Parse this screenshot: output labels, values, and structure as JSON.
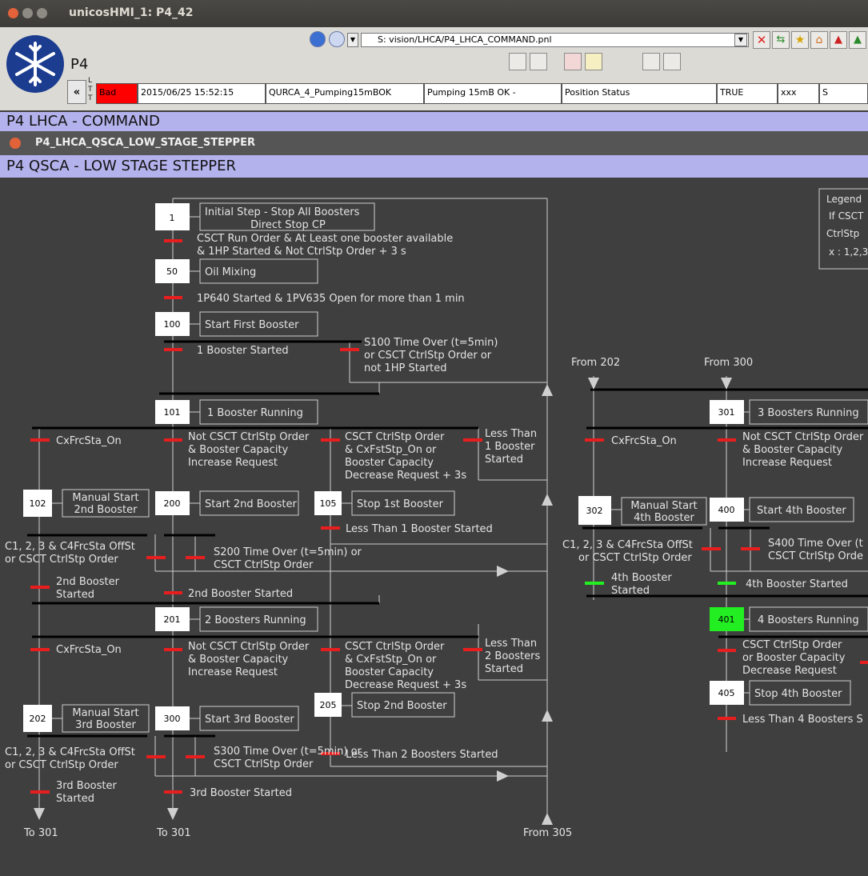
{
  "window": {
    "title": "unicosHMI_1: P4_42"
  },
  "toolbar": {
    "panel_name": "P4",
    "url": "S: vision/LHCA/P4_LHCA_COMMAND.pnl",
    "collapse_label": "«",
    "ltt_label": "L T T"
  },
  "alarm": {
    "status": "Bad",
    "timestamp": "2015/06/25 15:52:15",
    "object": "QURCA_4_Pumping15mBOK",
    "description": "Pumping 15mB OK -",
    "domain": "Position Status",
    "value": "TRUE",
    "extra1": "xxx",
    "extra2": "S"
  },
  "panel": {
    "header": "P4 LHCA - COMMAND",
    "subpanel_title": "P4_LHCA_QSCA_LOW_STAGE_STEPPER",
    "title": "P4 QSCA - LOW STAGE STEPPER"
  },
  "colors": {
    "active_step": "#22ee22",
    "transition_false": "#e81e1e",
    "transition_true": "#22ee22",
    "header_bg": "#b4b2ec",
    "alarm_red": "#ff0000"
  },
  "legend": {
    "title": "Legend",
    "line1": "If CSCT",
    "line2": "CtrlStp",
    "line3": "x : 1,2,3"
  },
  "steps": {
    "s1": {
      "num": "1",
      "line1": "Initial Step - Stop All Boosters",
      "line2": "Direct Stop CP"
    },
    "s50": {
      "num": "50",
      "label": "Oil Mixing"
    },
    "s100": {
      "num": "100",
      "label": "Start First Booster"
    },
    "s101": {
      "num": "101",
      "label": "1 Booster Running"
    },
    "s102": {
      "num": "102",
      "line1": "Manual Start",
      "line2": "2nd Booster"
    },
    "s200": {
      "num": "200",
      "label": "Start 2nd Booster"
    },
    "s105": {
      "num": "105",
      "label": "Stop 1st Booster"
    },
    "s201": {
      "num": "201",
      "label": "2 Boosters Running"
    },
    "s202": {
      "num": "202",
      "line1": "Manual Start",
      "line2": "3rd Booster"
    },
    "s300": {
      "num": "300",
      "label": "Start 3rd Booster"
    },
    "s205": {
      "num": "205",
      "label": "Stop 2nd Booster"
    },
    "s301": {
      "num": "301",
      "label": "3 Boosters Running"
    },
    "s302": {
      "num": "302",
      "line1": "Manual Start",
      "line2": "4th Booster"
    },
    "s400": {
      "num": "400",
      "label": "Start 4th Booster"
    },
    "s401": {
      "num": "401",
      "label": "4 Boosters Running"
    },
    "s405": {
      "num": "405",
      "label": "Stop 4th Booster"
    }
  },
  "transitions": {
    "t1_l1": "CSCT Run Order &  At Least one booster available",
    "t1_l2": "& 1HP Started &  Not CtrlStp Order + 3 s",
    "t50": "1P640 Started & 1PV635 Open for more than 1 min",
    "t100a": "1 Booster Started",
    "t100b_l1": "S100 Time Over (t=5min)",
    "t100b_l2": "or CSCT CtrlStp Order or",
    "t100b_l3": "not 1HP Started",
    "t101a": "CxFrcSta_On",
    "t101b_l1": "Not CSCT CtrlStp Order",
    "t101b_l2": "& Booster Capacity",
    "t101b_l3": "Increase Request",
    "t101c_l1": "CSCT CtrlStp Order",
    "t101c_l2": "& CxFstStp_On or",
    "t101c_l3": "Booster Capacity",
    "t101c_l4": "Decrease Request + 3s",
    "t101d_l1": "Less Than",
    "t101d_l2": "1 Booster",
    "t101d_l3": "Started",
    "t105": "Less Than 1 Booster Started",
    "t102a_l1": "C1, 2, 3 & C4FrcSta OffSt",
    "t102a_l2": "or CSCT CtrlStp Order",
    "t200b_l1": "S200 Time Over (t=5min) or",
    "t200b_l2": "CSCT CtrlStp Order",
    "t102b_l1": "2nd Booster",
    "t102b_l2": "Started",
    "t200a": "2nd Booster Started",
    "t201a": "CxFrcSta_On",
    "t201b_l1": "Not CSCT CtrlStp Order",
    "t201b_l2": "& Booster Capacity",
    "t201b_l3": "Increase Request",
    "t201c_l1": "CSCT CtrlStp Order",
    "t201c_l2": "& CxFstStp_On or",
    "t201c_l3": "Booster Capacity",
    "t201c_l4": "Decrease Request + 3s",
    "t201d_l1": "Less Than",
    "t201d_l2": "2 Boosters",
    "t201d_l3": "Started",
    "t205": "Less Than 2 Boosters Started",
    "t202a_l1": "C1, 2, 3 & C4FrcSta OffSt",
    "t202a_l2": "or CSCT CtrlStp Order",
    "t300b_l1": "S300 Time Over (t=5min) or",
    "t300b_l2": "CSCT CtrlStp Order",
    "t202b_l1": "3rd Booster",
    "t202b_l2": "Started",
    "t300a": "3rd Booster Started",
    "t301a": "CxFrcSta_On",
    "t301b_l1": "Not CSCT CtrlStp Order",
    "t301b_l2": "& Booster Capacity",
    "t301b_l3": "Increase Request",
    "t302a_l1": "C1, 2, 3 & C4FrcSta OffSt",
    "t302a_l2": "or CSCT CtrlStp Order",
    "t400b_l1": "S400 Time Over (t",
    "t400b_l2": "CSCT CtrlStp Orde",
    "t302b_l1": "4th Booster",
    "t302b_l2": "Started",
    "t400a": "4th Booster Started",
    "t401_l1": "CSCT CtrlStp Order",
    "t401_l2": "or Booster Capacity",
    "t401_l3": "Decrease Request",
    "t405": "Less Than 4 Boosters S"
  },
  "refs": {
    "to301a": "To 301",
    "to301b": "To 301",
    "from305": "From 305",
    "from202": "From 202",
    "from300": "From 300"
  }
}
